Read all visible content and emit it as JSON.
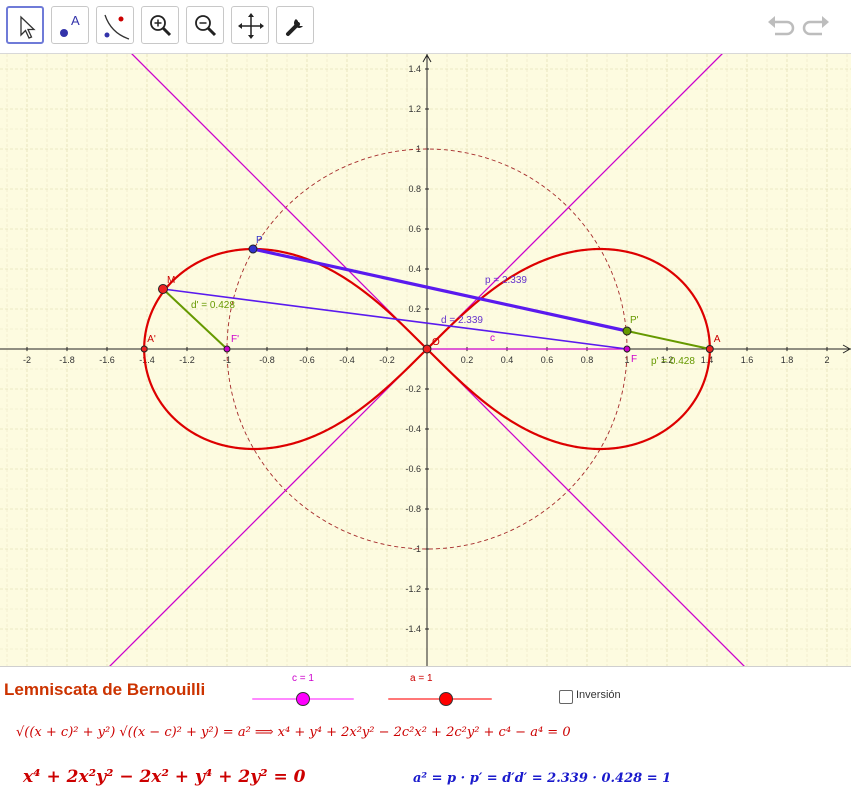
{
  "toolbar": {
    "tools": [
      {
        "name": "move",
        "icon": "pointer-arrow-icon",
        "active": true
      },
      {
        "name": "point",
        "icon": "point-icon",
        "label": "A"
      },
      {
        "name": "locus",
        "icon": "locus-icon"
      },
      {
        "name": "zoom_in",
        "icon": "zoom-in-icon"
      },
      {
        "name": "zoom_out",
        "icon": "zoom-out-icon"
      },
      {
        "name": "move_view",
        "icon": "move-view-icon"
      },
      {
        "name": "settings",
        "icon": "wrench-icon"
      }
    ],
    "undo_icon": "undo-icon",
    "redo_icon": "redo-icon"
  },
  "graph": {
    "background": "#fdfbe0",
    "x_ticks": [
      "-2",
      "-1.8",
      "-1.6",
      "-1.4",
      "-1.2",
      "-1",
      "-0.8",
      "-0.6",
      "-0.4",
      "-0.2",
      "0.2",
      "0.4",
      "0.6",
      "0.8",
      "1",
      "1.2",
      "1.4",
      "1.6",
      "1.8",
      "2"
    ],
    "y_ticks": [
      "1.4",
      "1.2",
      "1",
      "0.8",
      "0.6",
      "0.4",
      "0.2",
      "-0.2",
      "-0.4",
      "-0.6",
      "-0.8",
      "-1",
      "-1.2",
      "-1.4"
    ],
    "x_range": [
      -2.1,
      2.1
    ],
    "y_range": [
      -1.58,
      1.48
    ],
    "a": 1,
    "c": 1,
    "points": {
      "M": {
        "label": "M",
        "x": -1.32,
        "y": 0.3
      },
      "P": {
        "label": "P",
        "x": -0.87,
        "y": 0.5
      },
      "P_prime": {
        "label": "P'",
        "x": 1.0,
        "y": 0.09
      },
      "O": {
        "label": "O",
        "x": 0,
        "y": 0
      },
      "A": {
        "label": "A",
        "x": 1.414,
        "y": 0
      },
      "A_prime": {
        "label": "A'",
        "x": -1.414,
        "y": 0
      },
      "F": {
        "label": "F",
        "x": 1,
        "y": 0
      },
      "F_prime": {
        "label": "F'",
        "x": -1,
        "y": 0
      }
    },
    "segment_labels": {
      "p": "p = 2.339",
      "d": "d = 2.339",
      "d_prime": "d' = 0.428",
      "p_prime": "p' = 0.428",
      "c": "c"
    },
    "colors": {
      "lemniscate": "#dd0000",
      "asymptotes": "#cc00cc",
      "circle": "#a52a2a",
      "p_segment": "#5a1aee",
      "d_segment": "#5a1aee",
      "green_segment": "#669900",
      "c_segment": "#cc00cc"
    }
  },
  "panel": {
    "title": "Lemniscata de Bernouilli",
    "slider_c": {
      "label": "c = 1",
      "value": 1,
      "min": 0,
      "max": 2,
      "color": "#ff66ff",
      "knob": "#ff00ff"
    },
    "slider_a": {
      "label": "a = 1",
      "value": 1,
      "min": 0,
      "max": 1.8,
      "color": "#ff6666",
      "knob": "#ff0000"
    },
    "checkbox_label": "Inversión",
    "checkbox_checked": false,
    "formula1": "√((x + c)² + y²) √((x − c)² + y²) = a²  ⟹  x⁴ + y⁴ + 2x²y² − 2c²x² + 2c²y² + c⁴ − a⁴ = 0",
    "formula2": "x⁴ + 2x²y² − 2x² + y⁴ + 2y² = 0",
    "formula3": "a² = p · p′ = d′d′ = 2.339 · 0.428 = 1"
  }
}
